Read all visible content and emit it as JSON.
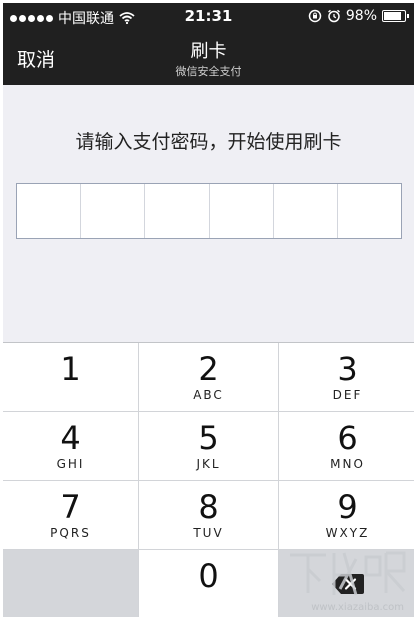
{
  "status_bar": {
    "carrier": "中国联通",
    "time": "21:31",
    "battery": "98%",
    "icons": [
      "signal-dots-icon",
      "wifi-icon",
      "rotation-lock-icon",
      "alarm-icon",
      "battery-icon"
    ]
  },
  "nav": {
    "cancel_label": "取消",
    "title": "刷卡",
    "subtitle": "微信安全支付"
  },
  "prompt": "请输入支付密码，开始使用刷卡",
  "password": {
    "length": 6,
    "entered": 0
  },
  "keypad": {
    "keys": [
      {
        "digit": "1",
        "letters": ""
      },
      {
        "digit": "2",
        "letters": "ABC"
      },
      {
        "digit": "3",
        "letters": "DEF"
      },
      {
        "digit": "4",
        "letters": "GHI"
      },
      {
        "digit": "5",
        "letters": "JKL"
      },
      {
        "digit": "6",
        "letters": "MNO"
      },
      {
        "digit": "7",
        "letters": "PQRS"
      },
      {
        "digit": "8",
        "letters": "TUV"
      },
      {
        "digit": "9",
        "letters": "WXYZ"
      },
      {
        "digit": "0",
        "letters": ""
      }
    ],
    "delete_icon": "backspace-icon"
  },
  "watermark": {
    "text": "www.xiazaiba.com"
  },
  "colors": {
    "nav_background": "#202020",
    "page_background": "#efeff4",
    "keypad_gray": "#d4d6da",
    "input_border": "#9aa3b5"
  }
}
